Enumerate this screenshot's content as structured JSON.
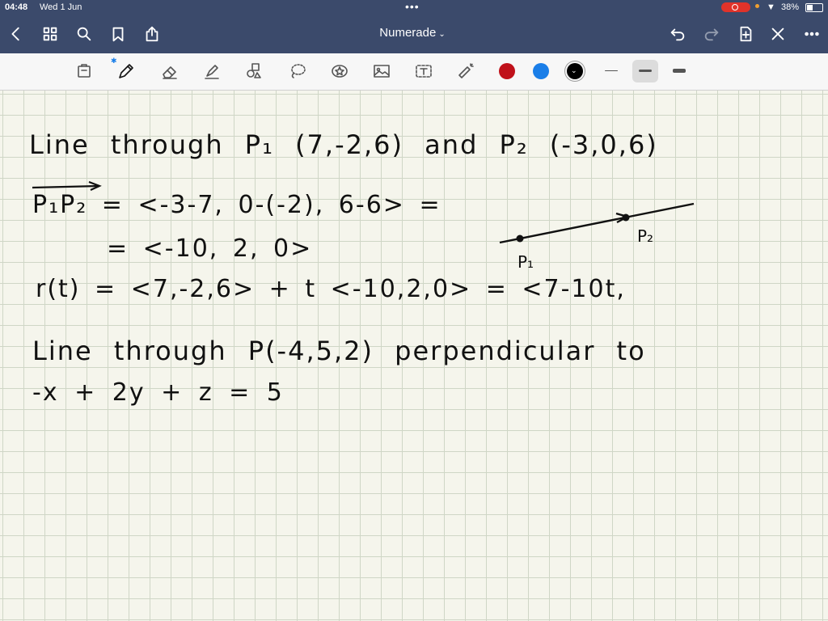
{
  "status_bar": {
    "time": "04:48",
    "date": "Wed 1 Jun",
    "battery": "38%"
  },
  "nav": {
    "title": "Numerade"
  },
  "toolbar": {
    "colors": [
      "#c0111a",
      "#1a7ee8",
      "#000000"
    ],
    "selected_color": "#000000"
  },
  "notes": {
    "line1": "Line through P₁ (7,-2,6)  and  P₂ (-3,0,6)",
    "line2": "P₁P₂ = <-3-7, 0-(-2), 6-6> =",
    "line3": "= <-10, 2, 0>",
    "line4": "r(t) = <7,-2,6> + t <-10,2,0> = <7-10t,",
    "line5": "Line through P(-4,5,2)  perpendicular to",
    "line6": "-x + 2y + z = 5",
    "point1_label": "P₁",
    "point2_label": "P₂"
  }
}
